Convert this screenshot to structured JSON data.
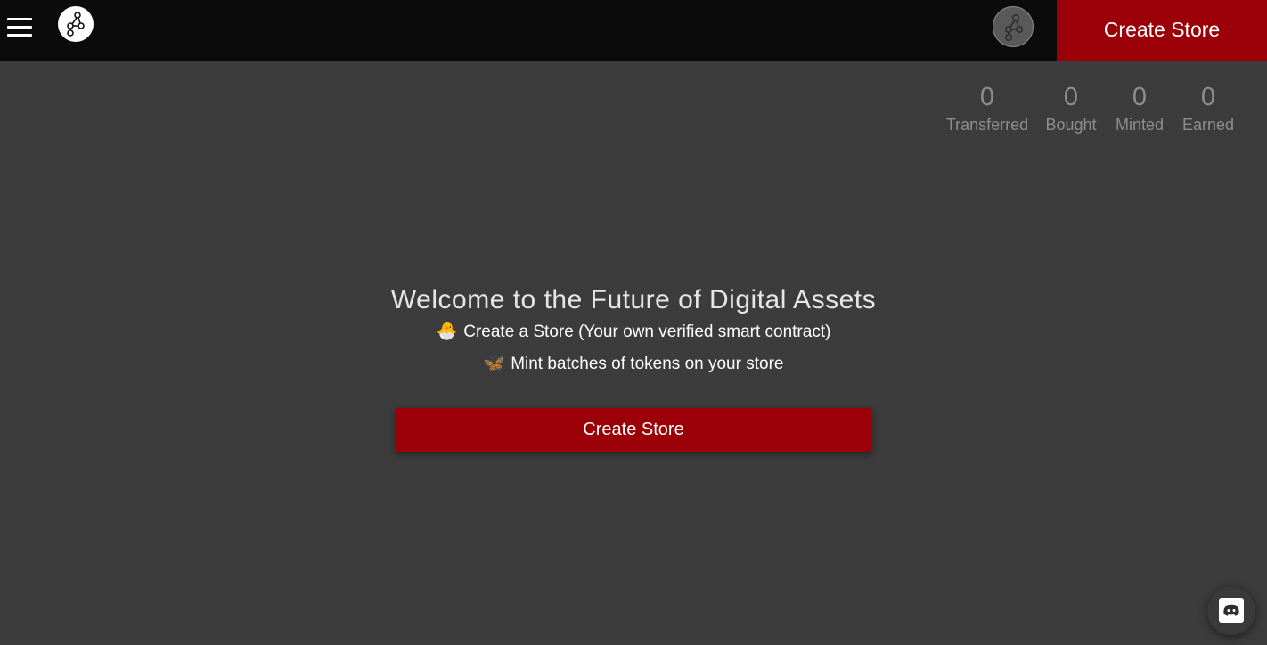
{
  "header": {
    "create_store_label": "Create Store",
    "menu_icon": "hamburger-menu-icon",
    "logo_icon": "network-logo-icon",
    "avatar_icon": "network-avatar-icon"
  },
  "stats": [
    {
      "value": "0",
      "label": "Transferred"
    },
    {
      "value": "0",
      "label": "Bought"
    },
    {
      "value": "0",
      "label": "Minted"
    },
    {
      "value": "0",
      "label": "Earned"
    }
  ],
  "hero": {
    "title": "Welcome to the Future of Digital Assets",
    "bullets": [
      {
        "emoji": "🐣",
        "text": "Create a Store (Your own verified smart contract)"
      },
      {
        "emoji": "🦋",
        "text": "Mint batches of tokens on your store"
      }
    ],
    "create_store_label": "Create Store"
  },
  "colors": {
    "accent": "#9b0008",
    "topbar": "#0b0b0b",
    "background": "#3c3c3c"
  },
  "discord_icon": "discord-icon"
}
